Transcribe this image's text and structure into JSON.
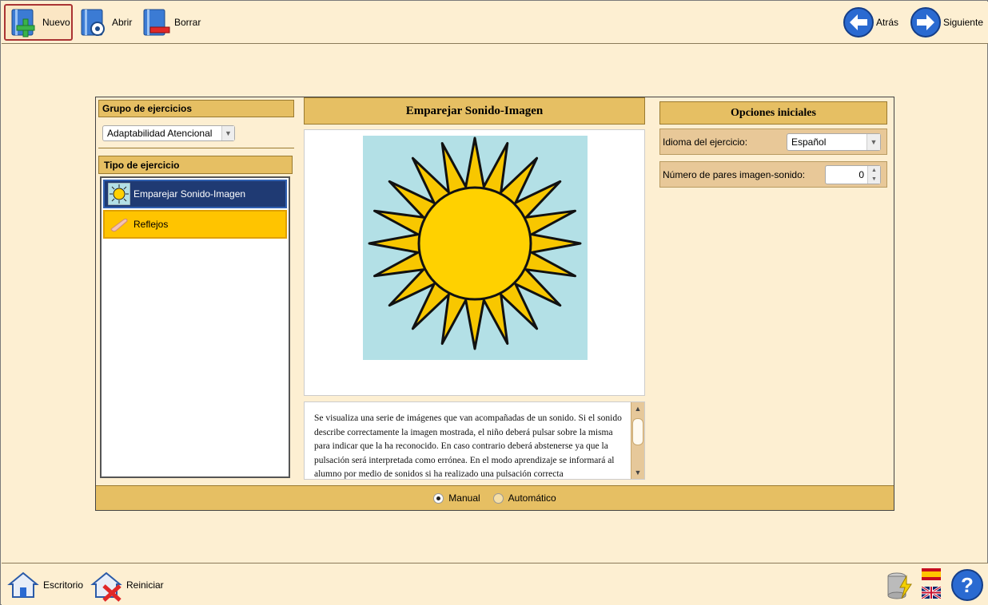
{
  "toolbar": {
    "new_label": "Nuevo",
    "open_label": "Abrir",
    "delete_label": "Borrar",
    "back_label": "Atrás",
    "next_label": "Siguiente"
  },
  "left": {
    "group_header": "Grupo de ejercicios",
    "group_selected": "Adaptabilidad Atencional",
    "type_header": "Tipo de ejercicio",
    "items": [
      {
        "label": "Emparejar Sonido-Imagen",
        "icon": "sun-icon"
      },
      {
        "label": "Reflejos",
        "icon": "finger-icon"
      }
    ]
  },
  "center": {
    "title": "Emparejar Sonido-Imagen",
    "description": "Se visualiza una serie de imágenes que van acompañadas de un sonido. Si el sonido describe correctamente la imagen mostrada, el niño deberá pulsar sobre la misma para indicar que la ha reconocido. En caso contrario deberá abstenerse ya que la pulsación será interpretada como errónea. En el modo aprendizaje se informará al alumno por medio de sonidos si ha realizado una pulsación correcta"
  },
  "options": {
    "title": "Opciones iniciales",
    "language_label": "Idioma del ejercicio:",
    "language_value": "Español",
    "pairs_label": "Número de pares imagen-sonido:",
    "pairs_value": "0"
  },
  "mode": {
    "manual_label": "Manual",
    "auto_label": "Automático",
    "selected": "Manual"
  },
  "bottom": {
    "desktop_label": "Escritorio",
    "restart_label": "Reiniciar"
  },
  "colors": {
    "background": "#fdefd2",
    "header": "#e6bf63",
    "selected_item": "#1f3a73",
    "highlight_item": "#ffc400"
  }
}
